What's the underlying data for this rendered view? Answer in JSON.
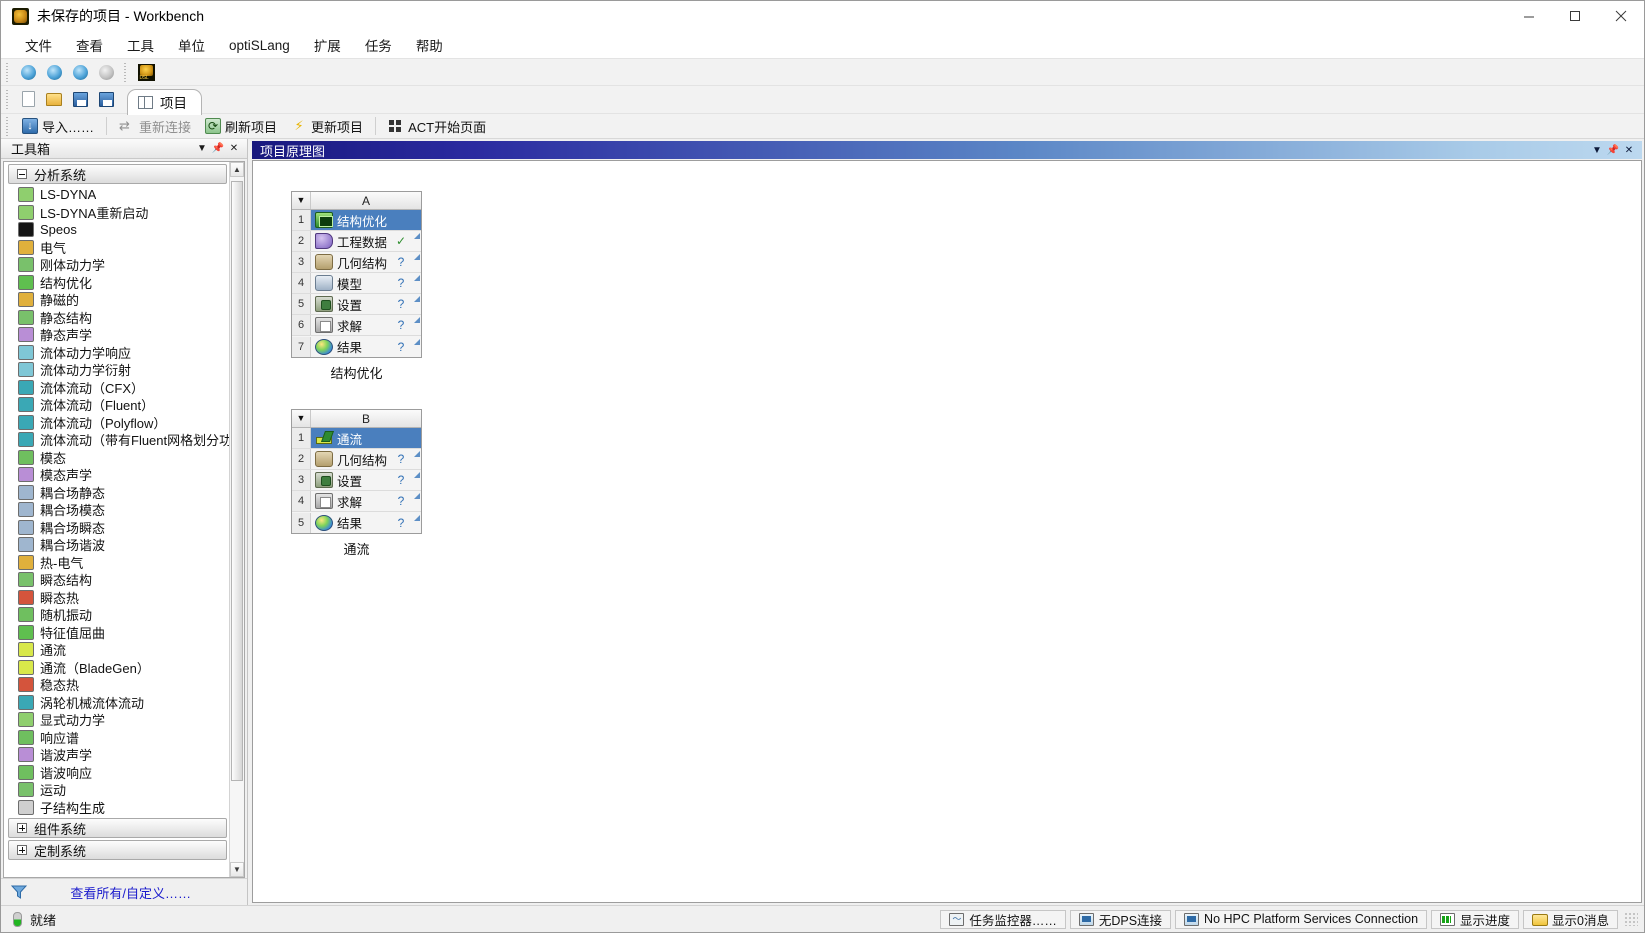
{
  "window": {
    "title": "未保存的项目 - Workbench",
    "app_icon": "ansys-workbench-icon",
    "controls": {
      "minimize": "minimize-icon",
      "maximize": "maximize-icon",
      "close": "close-icon"
    }
  },
  "menu": [
    "文件",
    "查看",
    "工具",
    "单位",
    "optiSLang",
    "扩展",
    "任务",
    "帮助"
  ],
  "toolbar_top": [
    {
      "name": "new-remote-icon",
      "glyph": "ic-globe"
    },
    {
      "name": "connect-icon",
      "glyph": "ic-globe"
    },
    {
      "name": "add-remote-icon",
      "glyph": "ic-globe"
    },
    {
      "name": "disconnected-icon",
      "glyph": "ic-globe-gray"
    },
    {
      "name": "optislang-dsl-icon",
      "glyph": "ic-acticon"
    }
  ],
  "toolbar_file": [
    {
      "name": "new-project-icon",
      "glyph": "ic-doc"
    },
    {
      "name": "open-project-icon",
      "glyph": "ic-folder"
    },
    {
      "name": "save-project-icon",
      "glyph": "ic-save"
    },
    {
      "name": "save-as-icon",
      "glyph": "ic-save"
    }
  ],
  "tab": {
    "label": "项目",
    "icon": "project-tab-icon"
  },
  "toolbar_actions": [
    {
      "label": "导入……",
      "icon": "import-icon",
      "dim": false
    },
    {
      "label": "重新连接",
      "icon": "reconnect-icon",
      "dim": true
    },
    {
      "label": "刷新项目",
      "icon": "refresh-project-icon",
      "dim": false
    },
    {
      "label": "更新项目",
      "icon": "update-project-icon",
      "dim": false
    },
    {
      "label": "ACT开始页面",
      "icon": "act-start-page-icon",
      "dim": false
    }
  ],
  "toolbox": {
    "title": "工具箱",
    "caption_buttons": [
      "chevron-down-icon",
      "pin-icon",
      "close-icon"
    ],
    "groups": [
      {
        "label": "分析系统",
        "expanded": true,
        "items": [
          {
            "label": "LS-DYNA",
            "icon": "ls-dyna-icon",
            "color": "#8fcf6e"
          },
          {
            "label": "LS-DYNA重新启动",
            "icon": "ls-dyna-restart-icon",
            "color": "#8fcf6e"
          },
          {
            "label": "Speos",
            "icon": "speos-icon",
            "color": "#151515"
          },
          {
            "label": "电气",
            "icon": "electric-icon",
            "color": "#e0b03c"
          },
          {
            "label": "刚体动力学",
            "icon": "rigid-dynamics-icon",
            "color": "#79c16b"
          },
          {
            "label": "结构优化",
            "icon": "structural-optimization-icon",
            "color": "#5fbf4f"
          },
          {
            "label": "静磁的",
            "icon": "magnetostatic-icon",
            "color": "#e0b03c"
          },
          {
            "label": "静态结构",
            "icon": "static-structural-icon",
            "color": "#79c16b"
          },
          {
            "label": "静态声学",
            "icon": "static-acoustics-icon",
            "color": "#b98ed6"
          },
          {
            "label": "流体动力学响应",
            "icon": "hydrodynamic-response-icon",
            "color": "#7fc7d6"
          },
          {
            "label": "流体动力学衍射",
            "icon": "hydrodynamic-diffraction-icon",
            "color": "#7fc7d6"
          },
          {
            "label": "流体流动（CFX）",
            "icon": "fluid-flow-cfx-icon",
            "color": "#3aa8b5"
          },
          {
            "label": "流体流动（Fluent）",
            "icon": "fluid-flow-fluent-icon",
            "color": "#3aa8b5"
          },
          {
            "label": "流体流动（Polyflow）",
            "icon": "fluid-flow-polyflow-icon",
            "color": "#3aa8b5"
          },
          {
            "label": "流体流动（带有Fluent网格划分功能的",
            "icon": "fluid-flow-fluent-meshing-icon",
            "color": "#3aa8b5"
          },
          {
            "label": "模态",
            "icon": "modal-icon",
            "color": "#6fbf5f"
          },
          {
            "label": "模态声学",
            "icon": "modal-acoustics-icon",
            "color": "#b98ed6"
          },
          {
            "label": "耦合场静态",
            "icon": "coupled-field-static-icon",
            "color": "#9fb6cf"
          },
          {
            "label": "耦合场模态",
            "icon": "coupled-field-modal-icon",
            "color": "#9fb6cf"
          },
          {
            "label": "耦合场瞬态",
            "icon": "coupled-field-transient-icon",
            "color": "#9fb6cf"
          },
          {
            "label": "耦合场谐波",
            "icon": "coupled-field-harmonic-icon",
            "color": "#9fb6cf"
          },
          {
            "label": "热-电气",
            "icon": "thermal-electric-icon",
            "color": "#e0b03c"
          },
          {
            "label": "瞬态结构",
            "icon": "transient-structural-icon",
            "color": "#79c16b"
          },
          {
            "label": "瞬态热",
            "icon": "transient-thermal-icon",
            "color": "#d4543c"
          },
          {
            "label": "随机振动",
            "icon": "random-vibration-icon",
            "color": "#6fbf5f"
          },
          {
            "label": "特征值屈曲",
            "icon": "eigenvalue-buckling-icon",
            "color": "#5fbf4f"
          },
          {
            "label": "通流",
            "icon": "throughflow-icon",
            "color": "#d8e84a"
          },
          {
            "label": "通流（BladeGen）",
            "icon": "throughflow-bladegen-icon",
            "color": "#d8e84a"
          },
          {
            "label": "稳态热",
            "icon": "steady-state-thermal-icon",
            "color": "#d4543c"
          },
          {
            "label": "涡轮机械流体流动",
            "icon": "turbomachinery-fluid-flow-icon",
            "color": "#3aa8b5"
          },
          {
            "label": "显式动力学",
            "icon": "explicit-dynamics-icon",
            "color": "#8fcf6e"
          },
          {
            "label": "响应谱",
            "icon": "response-spectrum-icon",
            "color": "#6fbf5f"
          },
          {
            "label": "谐波声学",
            "icon": "harmonic-acoustics-icon",
            "color": "#b98ed6"
          },
          {
            "label": "谐波响应",
            "icon": "harmonic-response-icon",
            "color": "#6fbf5f"
          },
          {
            "label": "运动",
            "icon": "motion-icon",
            "color": "#79c16b"
          },
          {
            "label": "子结构生成",
            "icon": "substructure-generation-icon",
            "color": "#cfcfcf"
          }
        ]
      },
      {
        "label": "组件系统",
        "expanded": false,
        "items": []
      },
      {
        "label": "定制系统",
        "expanded": false,
        "items": []
      }
    ],
    "footer": {
      "filter_icon": "filter-funnel-icon",
      "view_all_label": "查看所有/自定义……"
    }
  },
  "schematic": {
    "title": "项目原理图",
    "caption_buttons": [
      "chevron-down-icon",
      "pin-icon",
      "close-icon"
    ],
    "systems": [
      {
        "letter": "A",
        "name": "结构优化",
        "rows": [
          {
            "num": "1",
            "label": "结构优化",
            "icon": "structural-optimization-icon",
            "glyph": "g-opt",
            "status": "",
            "header": true,
            "handle": false
          },
          {
            "num": "2",
            "label": "工程数据",
            "icon": "engineering-data-icon",
            "glyph": "g-eng",
            "status": "✓",
            "status_type": "ok",
            "header": false,
            "handle": true
          },
          {
            "num": "3",
            "label": "几何结构",
            "icon": "geometry-icon",
            "glyph": "g-geo",
            "status": "?",
            "status_type": "question",
            "header": false,
            "handle": true
          },
          {
            "num": "4",
            "label": "模型",
            "icon": "model-icon",
            "glyph": "g-mod",
            "status": "?",
            "status_type": "question",
            "header": false,
            "handle": true
          },
          {
            "num": "5",
            "label": "设置",
            "icon": "setup-icon",
            "glyph": "g-set",
            "status": "?",
            "status_type": "question",
            "header": false,
            "handle": true
          },
          {
            "num": "6",
            "label": "求解",
            "icon": "solution-icon",
            "glyph": "g-sol",
            "status": "?",
            "status_type": "question",
            "header": false,
            "handle": true
          },
          {
            "num": "7",
            "label": "结果",
            "icon": "results-icon",
            "glyph": "g-res",
            "status": "?",
            "status_type": "question",
            "header": false,
            "handle": true
          }
        ]
      },
      {
        "letter": "B",
        "name": "通流",
        "rows": [
          {
            "num": "1",
            "label": "通流",
            "icon": "throughflow-icon",
            "glyph": "g-flow",
            "status": "",
            "header": true,
            "handle": false
          },
          {
            "num": "2",
            "label": "几何结构",
            "icon": "geometry-icon",
            "glyph": "g-geo",
            "status": "?",
            "status_type": "question",
            "header": false,
            "handle": true
          },
          {
            "num": "3",
            "label": "设置",
            "icon": "setup-icon",
            "glyph": "g-set",
            "status": "?",
            "status_type": "question",
            "header": false,
            "handle": true
          },
          {
            "num": "4",
            "label": "求解",
            "icon": "solution-icon",
            "glyph": "g-sol",
            "status": "?",
            "status_type": "question",
            "header": false,
            "handle": true
          },
          {
            "num": "5",
            "label": "结果",
            "icon": "results-icon",
            "glyph": "g-res",
            "status": "?",
            "status_type": "question",
            "header": false,
            "handle": true
          }
        ]
      }
    ]
  },
  "statusbar": {
    "ready_label": "就绪",
    "ready_icon": "green-light-icon",
    "cells": [
      {
        "label": "任务监控器……",
        "icon": "job-monitor-icon",
        "glyph": "ic-chart"
      },
      {
        "label": "无DPS连接",
        "icon": "dps-connection-icon",
        "glyph": "ic-monitor"
      },
      {
        "label": "No HPC Platform Services Connection",
        "icon": "hpc-connection-icon",
        "glyph": "ic-monitor"
      },
      {
        "label": "显示进度",
        "icon": "show-progress-icon",
        "glyph": "ic-batt"
      },
      {
        "label": "显示0消息",
        "icon": "show-messages-icon",
        "glyph": "ic-msg"
      }
    ]
  },
  "accent": {
    "selection_blue": "#4a7fbe",
    "caption_blue": "#19197e",
    "link_blue": "#1a1acc"
  }
}
